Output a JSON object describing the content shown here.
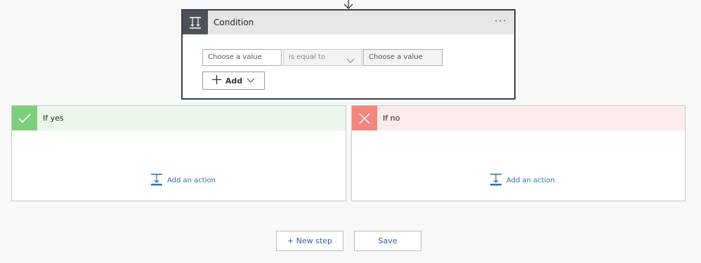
{
  "condition": {
    "title": "Condition",
    "more_label": "···",
    "left_placeholder": "Choose a value",
    "operator": "is equal to",
    "right_placeholder": "Choose a value",
    "add_label": "Add"
  },
  "branches": {
    "yes": {
      "title": "If yes",
      "add_action_label": "Add an action"
    },
    "no": {
      "title": "If no",
      "add_action_label": "Add an action"
    }
  },
  "footer": {
    "new_step_label": "+ New step",
    "save_label": "Save"
  },
  "colors": {
    "accent": "#2e75c5",
    "condition_header": "#4c525a",
    "yes_green": "#7dd07b",
    "no_red": "#f4857c"
  },
  "icons": {
    "top_connector": "arrow-down-icon",
    "condition": "condition-icon",
    "yes": "checkmark-icon",
    "no": "close-icon",
    "add_action": "add-action-icon",
    "add": "plus-icon",
    "dropdown": "chevron-down-icon"
  }
}
